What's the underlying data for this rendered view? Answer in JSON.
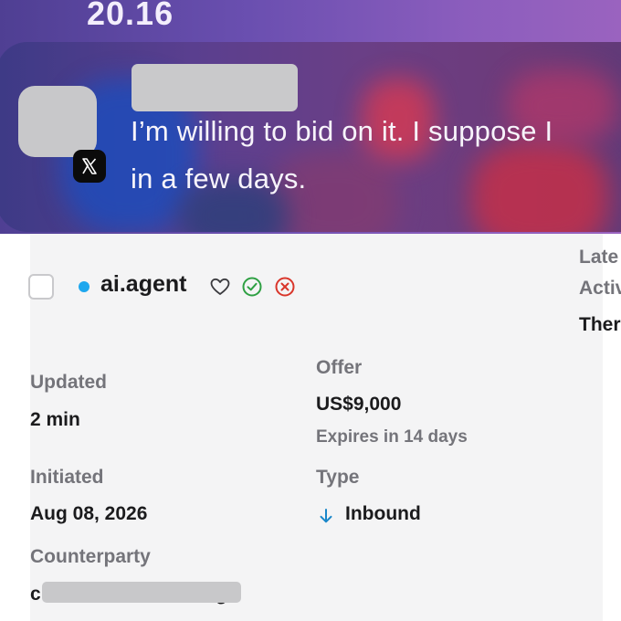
{
  "status_bar": {
    "time": "20.16"
  },
  "notification": {
    "app_icon": "x-logo-icon",
    "message_line1": "I’m willing to bid on it. I suppose I",
    "message_line2": "in a few days."
  },
  "item": {
    "name": "ai.agent",
    "status_color": "#1ea7ee",
    "actions": [
      "heart-icon",
      "check-circle-icon",
      "x-circle-icon"
    ]
  },
  "details": {
    "updated_label": "Updated",
    "updated_value": "2 min",
    "initiated_label": "Initiated",
    "initiated_value": "Aug 08, 2026",
    "counterparty_label": "Counterparty",
    "counterparty_value_start": "c",
    "counterparty_value_end": "g",
    "offer_label": "Offer",
    "offer_value": "US$9,000",
    "offer_expiry": "Expires in 14 days",
    "type_label": "Type",
    "type_value": "Inbound"
  },
  "right_column": {
    "latest_label_line1": "Late",
    "latest_label_line2": "Activ",
    "latest_value": "Ther"
  }
}
